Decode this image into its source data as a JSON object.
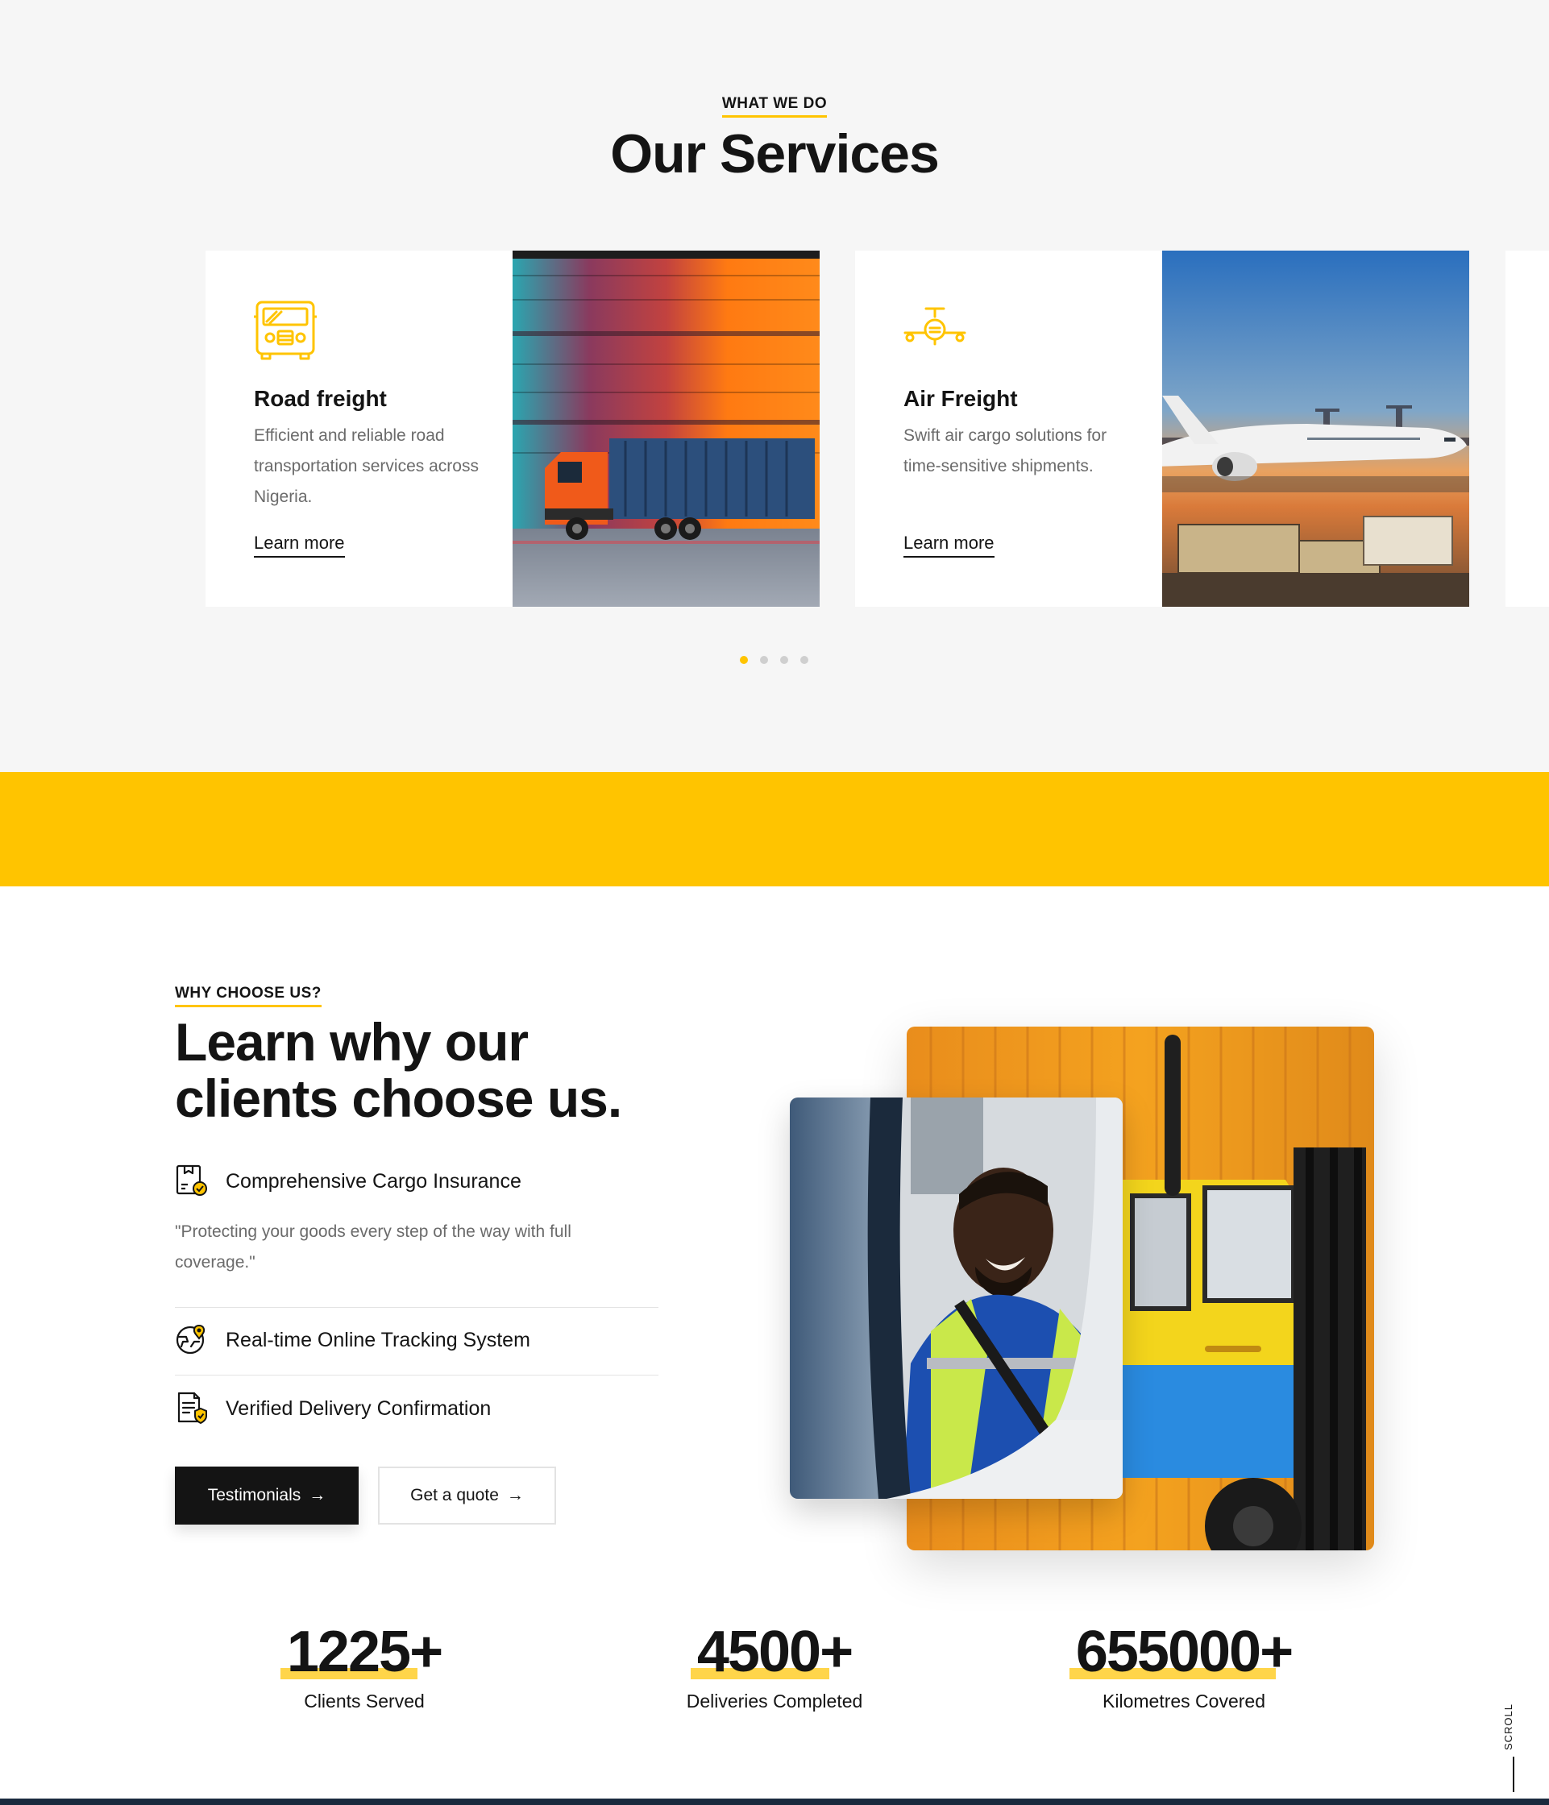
{
  "services": {
    "eyebrow": "WHAT WE DO",
    "title": "Our Services",
    "cards": [
      {
        "icon": "truck-icon",
        "title": "Road freight",
        "description": "Efficient and reliable road transportation services across Nigeria.",
        "link": "Learn more"
      },
      {
        "icon": "airplane-icon",
        "title": "Air Freight",
        "description": "Swift air cargo solutions for time-sensitive shipments.",
        "link": "Learn more"
      }
    ],
    "carousel": {
      "pages": 4,
      "active": 1
    }
  },
  "why": {
    "eyebrow": "WHY CHOOSE US?",
    "title_line1": "Learn why our",
    "title_line2": "clients choose us.",
    "features": [
      {
        "icon": "insurance-box-icon",
        "label": "Comprehensive Cargo Insurance",
        "description": "\"Protecting your goods every step of the way with full coverage.\""
      },
      {
        "icon": "tracking-icon",
        "label": "Real-time Online Tracking System"
      },
      {
        "icon": "verified-document-icon",
        "label": "Verified Delivery Confirmation"
      }
    ],
    "buttons": {
      "testimonials": "Testimonials",
      "quote": "Get a quote"
    }
  },
  "stats": [
    {
      "value": "1225",
      "suffix": "+",
      "label": "Clients Served"
    },
    {
      "value": "4500",
      "suffix": "+",
      "label": "Deliveries Completed"
    },
    {
      "value": "655000",
      "suffix": "+",
      "label": "Kilometres Covered"
    }
  ],
  "scroll_label": "SCROLL",
  "colors": {
    "accent": "#ffc400",
    "dark": "#141414",
    "muted": "#6b6b6b",
    "section_bg": "#f6f6f6"
  }
}
